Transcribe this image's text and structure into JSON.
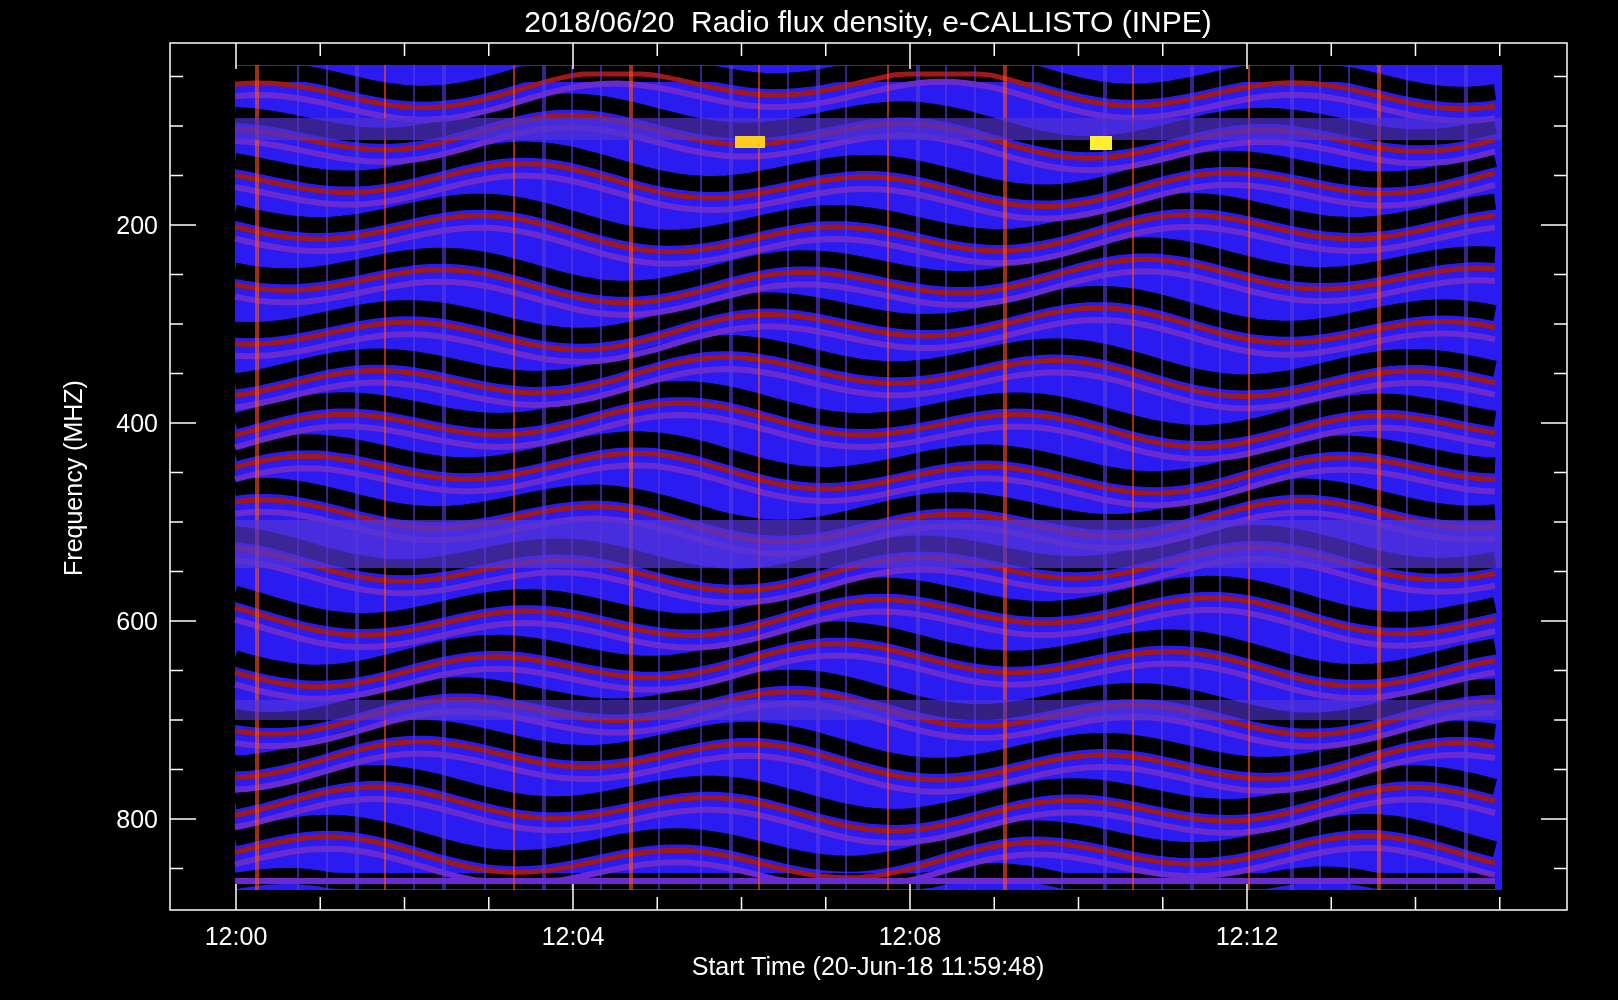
{
  "title": "2018/06/20  Radio flux density, e-CALLISTO (INPE)",
  "y_axis": {
    "label": "Frequency (MHZ)",
    "ticks": [
      "200",
      "400",
      "600",
      "800"
    ]
  },
  "x_axis": {
    "label": "Start Time (20-Jun-18 11:59:48)",
    "ticks": [
      "12:00",
      "12:04",
      "12:08",
      "12:12"
    ]
  }
}
